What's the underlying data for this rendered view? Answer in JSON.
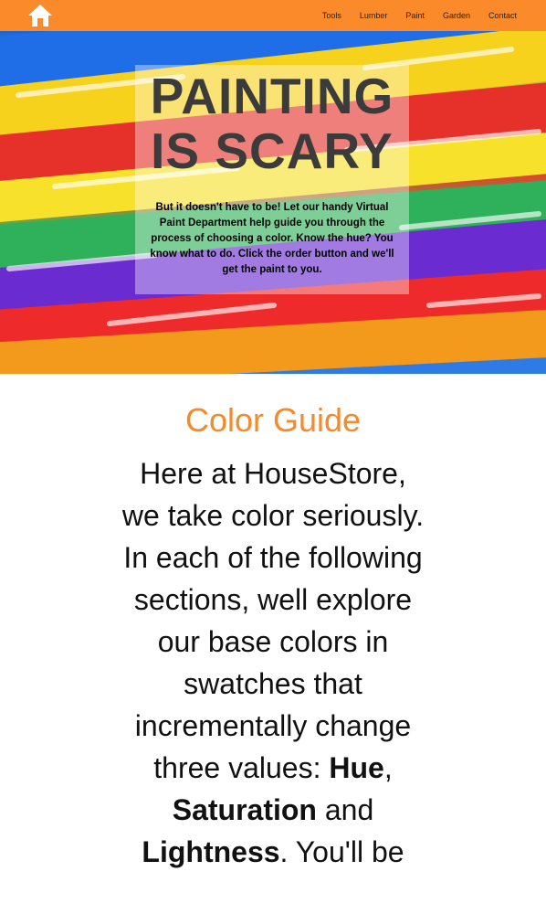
{
  "nav": {
    "items": [
      "Tools",
      "Lumber",
      "Paint",
      "Garden",
      "Contact"
    ]
  },
  "hero": {
    "title": "PAINTING IS SCARY",
    "text": "But it doesn't have to be! Let our handy Virtual Paint Department help guide you through the process of choosing a color. Know the hue? You know what to do. Click the order button and we'll get the paint to you."
  },
  "guide": {
    "title": "Color Guide",
    "intro_before": "Here at HouseStore, we take color seriously. In each of the following sections, well explore our base colors in swatches that incrementally change three values: ",
    "hue": "Hue",
    "comma": ", ",
    "saturation": "Saturation",
    "and": " and ",
    "lightness": "Lightness",
    "after": ". You'll be"
  },
  "colors": {
    "nav_bg": "#fb8a2a",
    "accent": "#f58a2a"
  }
}
